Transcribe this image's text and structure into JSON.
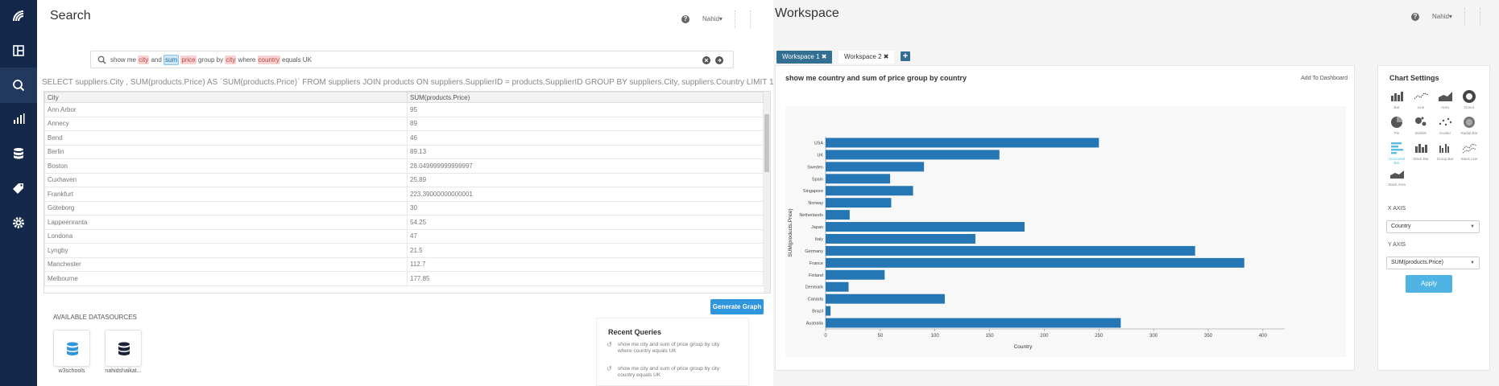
{
  "sidebar": {
    "items": [
      {
        "name": "logo-icon"
      },
      {
        "name": "dashboard-icon"
      },
      {
        "name": "search-icon",
        "active": true
      },
      {
        "name": "analytics-icon"
      },
      {
        "name": "database-icon"
      },
      {
        "name": "tag-icon"
      },
      {
        "name": "settings-icon"
      }
    ]
  },
  "search": {
    "title": "Search",
    "help": "?",
    "user": "Nahid▾",
    "query_tokens": [
      {
        "text": "show me ",
        "type": "plain"
      },
      {
        "text": "city",
        "type": "red"
      },
      {
        "text": " and ",
        "type": "plain"
      },
      {
        "text": "sum",
        "type": "blue"
      },
      {
        "text": " ",
        "type": "plain"
      },
      {
        "text": "price",
        "type": "red"
      },
      {
        "text": " group by ",
        "type": "plain"
      },
      {
        "text": "city",
        "type": "red"
      },
      {
        "text": " where ",
        "type": "plain"
      },
      {
        "text": "country",
        "type": "red"
      },
      {
        "text": " equals UK",
        "type": "plain"
      }
    ],
    "sql": "SELECT suppliers.City , SUM(products.Price) AS `SUM(products.Price)` FROM suppliers JOIN products ON suppliers.SupplierID = products.SupplierID GROUP BY suppliers.City, suppliers.Country LIMIT 10000 OFFSET 0",
    "table": {
      "columns": [
        "City",
        "SUM(products.Price)"
      ],
      "rows": [
        [
          "Ann Arbor",
          "95"
        ],
        [
          "Annecy",
          "89"
        ],
        [
          "Bend",
          "46"
        ],
        [
          "Berlin",
          "89.13"
        ],
        [
          "Boston",
          "28.049999999999997"
        ],
        [
          "Cuxhaven",
          "25.89"
        ],
        [
          "Frankfurt",
          "223.39000000000001"
        ],
        [
          "Göteborg",
          "30"
        ],
        [
          "Lappeenranta",
          "54.25"
        ],
        [
          "Londona",
          "47"
        ],
        [
          "Lyngby",
          "21.5"
        ],
        [
          "Manchester",
          "112.7"
        ],
        [
          "Melbourne",
          "177.85"
        ]
      ]
    },
    "generate_button": "Generate Graph",
    "datasources_title": "AVAILABLE DATASOURCES",
    "datasources": [
      "w3schools",
      "nahidshaikat..."
    ],
    "recent_title": "Recent Queries",
    "recent_queries": [
      "show me city and sum of price group by city where country equals UK",
      "show me city and sum of price group by city country equals UK"
    ]
  },
  "workspace": {
    "title": "Workspace",
    "help": "?",
    "user": "Nahid▾",
    "tabs": [
      "Workspace 1 ✖",
      "Workspace 2 ✖"
    ],
    "add_tab": "+",
    "chart_title": "show me country and sum of price group by country",
    "add_to_dashboard": "Add To Dashboard"
  },
  "chart_data": {
    "type": "bar",
    "orientation": "horizontal",
    "categories": [
      "USA",
      "UK",
      "Sweden",
      "Spain",
      "Singapore",
      "Norway",
      "Netherlands",
      "Japan",
      "Italy",
      "Germany",
      "France",
      "Finland",
      "Denmark",
      "Canada",
      "Brazil",
      "Australia"
    ],
    "values": [
      250,
      159,
      90,
      59,
      80,
      60,
      22,
      182,
      137,
      338,
      383,
      54,
      21,
      109,
      4.5,
      270
    ],
    "xlabel": "Country",
    "ylabel": "SUM(products.Price)",
    "xlim": [
      0,
      420
    ],
    "xticks": [
      0,
      50,
      100,
      150,
      200,
      250,
      300,
      350,
      400
    ],
    "bar_color": "#2476b4",
    "grid": false
  },
  "settings": {
    "title": "Chart Settings",
    "chart_types": [
      "Bar",
      "Line",
      "Area",
      "Donut",
      "Pie",
      "Bubble",
      "Scatter",
      "Radial Bar",
      "Horizontal Bar",
      "Stack Bar",
      "Group Bar",
      "Stack Line",
      "Stack Area"
    ],
    "selected_type": "Horizontal Bar",
    "x_axis_label": "X AXIS",
    "x_axis_value": "Country",
    "y_axis_label": "Y AXIS",
    "y_axis_value": "SUM(products.Price)",
    "apply": "Apply"
  }
}
